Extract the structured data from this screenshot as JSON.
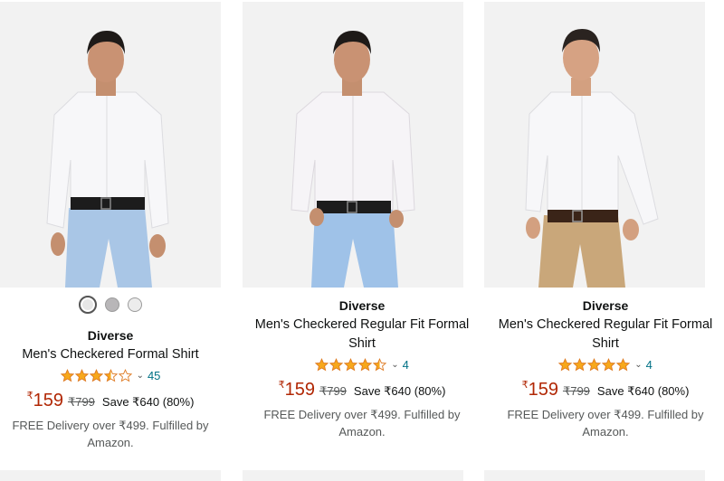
{
  "products": [
    {
      "brand": "Diverse",
      "title": "Men's Checkered Formal Shirt",
      "rating_stars": 3.5,
      "rating_count": "45",
      "price_symbol": "₹",
      "price": "159",
      "mrp": "₹799",
      "save": "Save ₹640 (80%)",
      "delivery": "FREE Delivery over ₹499. Fulfilled by Amazon.",
      "swatches": [
        "#e6e6e6",
        "#b8b6b8",
        "#ececec"
      ],
      "pants_color": "#a9c6e6"
    },
    {
      "brand": "Diverse",
      "title": "Men's Checkered Regular Fit Formal Shirt",
      "rating_stars": 4.5,
      "rating_count": "4",
      "price_symbol": "₹",
      "price": "159",
      "mrp": "₹799",
      "save": "Save ₹640 (80%)",
      "delivery": "FREE Delivery over ₹499. Fulfilled by Amazon.",
      "pants_color": "#9fc2e8"
    },
    {
      "brand": "Diverse",
      "title": "Men's Checkered Regular Fit Formal Shirt",
      "rating_stars": 5,
      "rating_count": "4",
      "price_symbol": "₹",
      "price": "159",
      "mrp": "₹799",
      "save": "Save ₹640 (80%)",
      "delivery": "FREE Delivery over ₹499. Fulfilled by Amazon.",
      "pants_color": "#c9a77a"
    }
  ],
  "colors": {
    "price": "#b12704",
    "link": "#007185",
    "star": "#f7a81b"
  }
}
